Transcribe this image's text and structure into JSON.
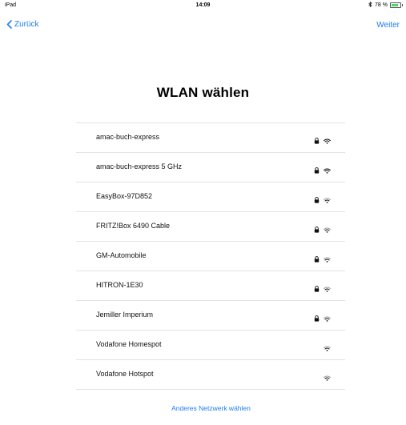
{
  "status_bar": {
    "device": "iPad",
    "time": "14:09",
    "bluetooth_icon": "bluetooth-icon",
    "battery_text": "78 %",
    "battery_level": 0.78,
    "battery_color": "#4cd964"
  },
  "nav": {
    "back_label": "Zurück",
    "next_label": "Weiter",
    "accent_color": "#1e7cf5"
  },
  "title": "WLAN wählen",
  "networks": [
    {
      "name": "amac-buch-express",
      "secured": true,
      "signal": "strong"
    },
    {
      "name": "amac-buch-express 5 GHz",
      "secured": true,
      "signal": "strong"
    },
    {
      "name": "EasyBox-97D852",
      "secured": true,
      "signal": "medium"
    },
    {
      "name": "FRITZ!Box 6490 Cable",
      "secured": true,
      "signal": "medium"
    },
    {
      "name": "GM-Automobile",
      "secured": true,
      "signal": "medium"
    },
    {
      "name": "HITRON-1E30",
      "secured": true,
      "signal": "medium"
    },
    {
      "name": "Jemiller Imperium",
      "secured": true,
      "signal": "medium"
    },
    {
      "name": "Vodafone Homespot",
      "secured": false,
      "signal": "medium"
    },
    {
      "name": "Vodafone Hotspot",
      "secured": false,
      "signal": "medium"
    }
  ],
  "other_network_label": "Anderes Netzwerk wählen"
}
